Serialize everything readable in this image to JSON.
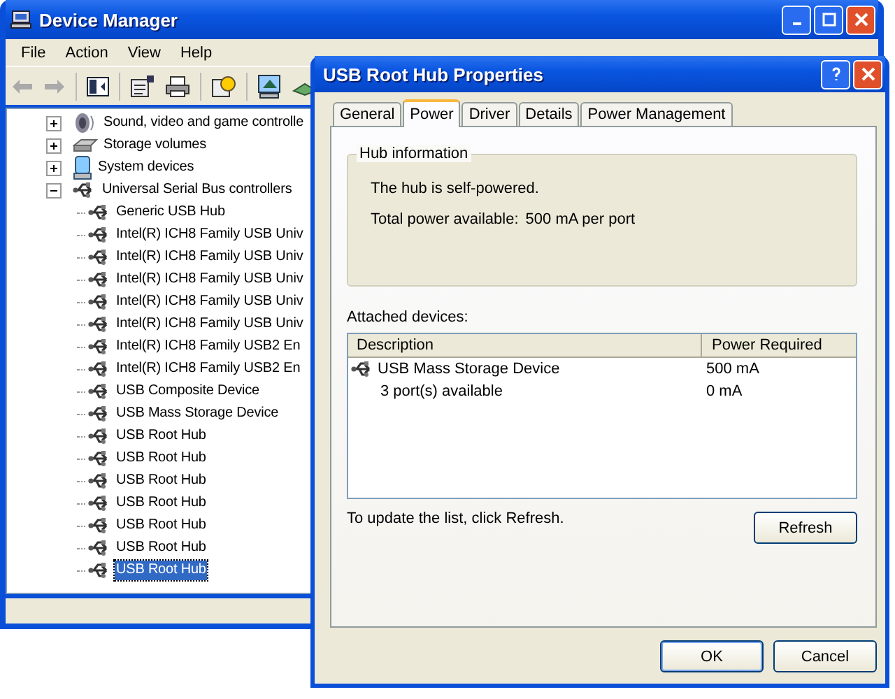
{
  "main_window": {
    "title": "Device Manager",
    "menu": [
      "File",
      "Action",
      "View",
      "Help"
    ],
    "tree": [
      {
        "label": "Sound, video and game controlle",
        "kind": "sound",
        "expanded": false,
        "selected": false
      },
      {
        "label": "Storage volumes",
        "kind": "storage",
        "expanded": false,
        "selected": false
      },
      {
        "label": "System devices",
        "kind": "system",
        "expanded": false,
        "selected": false
      },
      {
        "label": "Universal Serial Bus controllers",
        "kind": "usb",
        "expanded": true,
        "selected": false,
        "children": [
          {
            "label": "Generic USB Hub",
            "selected": false
          },
          {
            "label": "Intel(R) ICH8 Family USB Univ",
            "selected": false
          },
          {
            "label": "Intel(R) ICH8 Family USB Univ",
            "selected": false
          },
          {
            "label": "Intel(R) ICH8 Family USB Univ",
            "selected": false
          },
          {
            "label": "Intel(R) ICH8 Family USB Univ",
            "selected": false
          },
          {
            "label": "Intel(R) ICH8 Family USB Univ",
            "selected": false
          },
          {
            "label": "Intel(R) ICH8 Family USB2 En",
            "selected": false
          },
          {
            "label": "Intel(R) ICH8 Family USB2 En",
            "selected": false
          },
          {
            "label": "USB Composite Device",
            "selected": false
          },
          {
            "label": "USB Mass Storage Device",
            "selected": false
          },
          {
            "label": "USB Root Hub",
            "selected": false
          },
          {
            "label": "USB Root Hub",
            "selected": false
          },
          {
            "label": "USB Root Hub",
            "selected": false
          },
          {
            "label": "USB Root Hub",
            "selected": false
          },
          {
            "label": "USB Root Hub",
            "selected": false
          },
          {
            "label": "USB Root Hub",
            "selected": false
          },
          {
            "label": "USB Root Hub",
            "selected": true
          }
        ]
      }
    ]
  },
  "dialog": {
    "title": "USB Root Hub Properties",
    "tabs": [
      {
        "label": "General",
        "selected": false
      },
      {
        "label": "Power",
        "selected": true
      },
      {
        "label": "Driver",
        "selected": false
      },
      {
        "label": "Details",
        "selected": false
      },
      {
        "label": "Power Management",
        "selected": false
      }
    ],
    "hub_information": {
      "title": "Hub information",
      "status": "The hub is self-powered.",
      "power_label": "Total power available:",
      "power_value": "500 mA per port"
    },
    "attached_label": "Attached devices:",
    "columns": [
      "Description",
      "Power Required"
    ],
    "rows": [
      {
        "kind": "device",
        "description": "USB Mass Storage Device",
        "power": "500 mA"
      },
      {
        "kind": "summary",
        "description": "3 port(s) available",
        "power": "0 mA"
      }
    ],
    "hint": "To update the list, click Refresh.",
    "refresh_button": "Refresh",
    "buttons": [
      "OK",
      "Cancel"
    ]
  }
}
